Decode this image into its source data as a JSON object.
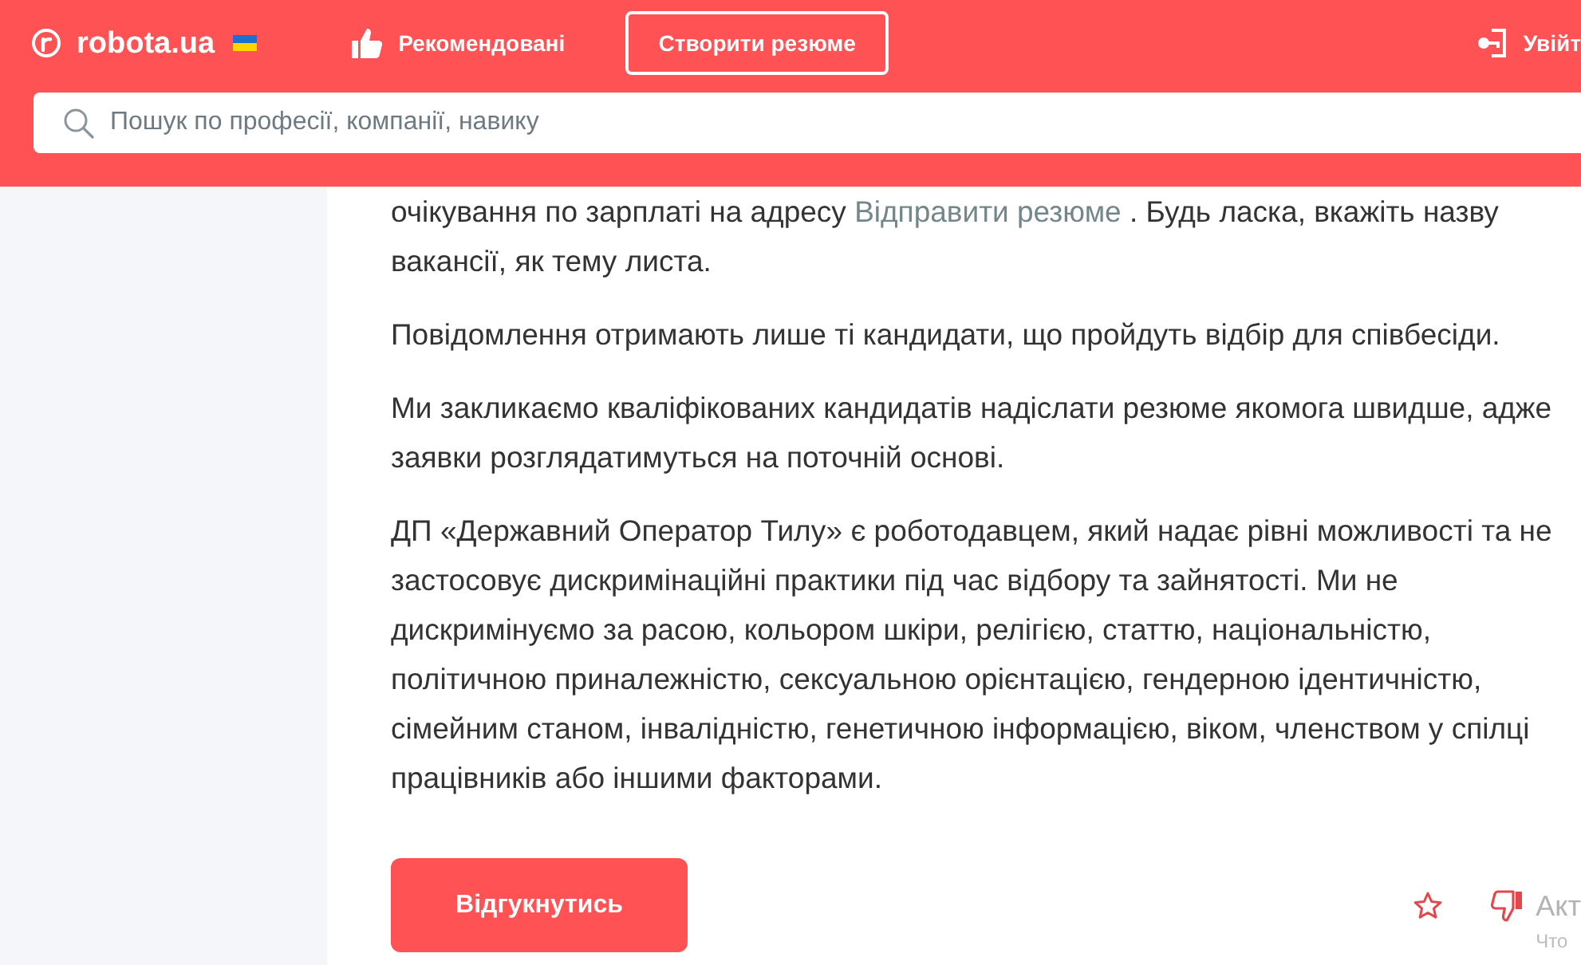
{
  "header": {
    "logo": "robota.ua",
    "nav": [
      {
        "kind": "icon_link",
        "label": "Рекомендовані"
      },
      {
        "kind": "outlined_button",
        "label": "Створити резюме"
      }
    ],
    "login": "Увійт"
  },
  "search": {
    "placeholder": "Пошук по професії, компанії, навику"
  },
  "description": [
    {
      "parts": [
        {
          "kind": "text",
          "text": "очікування по зарплаті на адресу "
        },
        {
          "kind": "link",
          "text": "Відправити резюме"
        },
        {
          "kind": "text",
          "text": " . Будь ласка, вкажіть назву вакансії, як тему листа."
        }
      ]
    },
    {
      "parts": [
        {
          "kind": "text",
          "text": "Повідомлення отримають лише ті кандидати, що пройдуть відбір для співбесіди."
        }
      ]
    },
    {
      "parts": [
        {
          "kind": "text",
          "text": "Ми закликаємо кваліфікованих кандидатів надіслати резюме якомога швидше, адже заявки розглядатимуться на поточній основі."
        }
      ]
    },
    {
      "parts": [
        {
          "kind": "text",
          "text": "ДП «Державний Оператор Тилу» є роботодавцем, який надає рівні можливості та не застосовує дискримінаційні практики під час відбору та зайнятості. Ми не дискримінуємо за расою, кольором шкіри, релігією, статтю, національністю, політичною приналежністю, сексуальною орієнтацією, гендерною ідентичністю, сімейним станом, інвалідністю, генетичною інформацією, віком, членством у спілці працівників або іншими факторами."
        }
      ]
    }
  ],
  "apply_button": "Відгукнутись",
  "feedback": {
    "title": "Акт",
    "subtitle": "Что"
  }
}
